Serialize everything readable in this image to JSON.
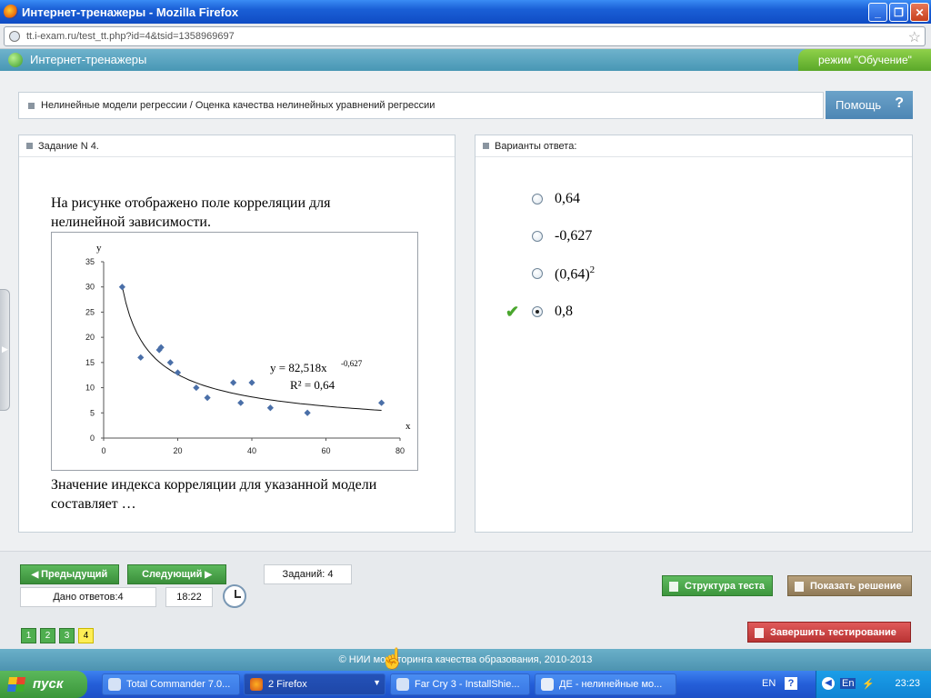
{
  "window": {
    "title": "Интернет-тренажеры - Mozilla Firefox",
    "url": "tt.i-exam.ru/test_tt.php?id=4&tsid=1358969697"
  },
  "app": {
    "name": "Интернет-тренажеры",
    "mode": "режим \"Обучение\""
  },
  "breadcrumb": "Нелинейные модели регрессии / Оценка качества нелинейных уравнений регрессии",
  "help_label": "Помощь",
  "task": {
    "header": "Задание N 4.",
    "text1_line1": "На рисунке отображено поле корреляции для",
    "text1_line2": "нелинейной зависимости.",
    "text2_line1": "Значение индекса корреляции для указанной модели",
    "text2_line2": "составляет …"
  },
  "answers": {
    "header": "Варианты ответа:",
    "items": [
      {
        "label": "0,64",
        "selected": false
      },
      {
        "label": "-0,627",
        "selected": false
      },
      {
        "label": "(0,64)",
        "sup": "2",
        "selected": false
      },
      {
        "label": "0,8",
        "selected": true
      }
    ]
  },
  "nav": {
    "prev": "Предыдущий",
    "next": "Следующий",
    "tasks_count": "Заданий: 4",
    "answered": "Дано ответов:4",
    "timer": "18:22",
    "structure": "Структура теста",
    "show_solution": "Показать решение",
    "finish": "Завершить тестирование",
    "pages": [
      "1",
      "2",
      "3",
      "4"
    ],
    "current_page": "4"
  },
  "footer": "© НИИ мониторинга качества образования, 2010-2013",
  "taskbar": {
    "start": "пуск",
    "tasks": [
      "Total Commander 7.0...",
      "2 Firefox",
      "Far Cry 3 - InstallShie...",
      "ДЕ - нелинейные мо..."
    ],
    "lang": "EN",
    "tray_lang": "En",
    "time": "23:23"
  },
  "chart_data": {
    "type": "scatter",
    "xlabel": "x",
    "ylabel": "y",
    "xlim": [
      0,
      80
    ],
    "ylim": [
      0,
      35
    ],
    "xticks": [
      0,
      20,
      40,
      60,
      80
    ],
    "yticks": [
      0,
      5,
      10,
      15,
      20,
      25,
      30,
      35
    ],
    "points": [
      [
        5,
        30
      ],
      [
        10,
        16
      ],
      [
        15,
        17.5
      ],
      [
        15.5,
        18
      ],
      [
        18,
        15
      ],
      [
        20,
        13
      ],
      [
        25,
        10
      ],
      [
        28,
        8
      ],
      [
        35,
        11
      ],
      [
        37,
        7
      ],
      [
        40,
        11
      ],
      [
        45,
        6
      ],
      [
        55,
        5
      ],
      [
        75,
        7
      ]
    ],
    "trend": {
      "a": 82.518,
      "b": -0.627,
      "x_from": 5,
      "x_to": 75
    },
    "equation": "y = 82,518x",
    "equation_exp": "-0,627",
    "r2": "R² = 0,64",
    "point_color": "#4a6fa8",
    "grid": false
  }
}
